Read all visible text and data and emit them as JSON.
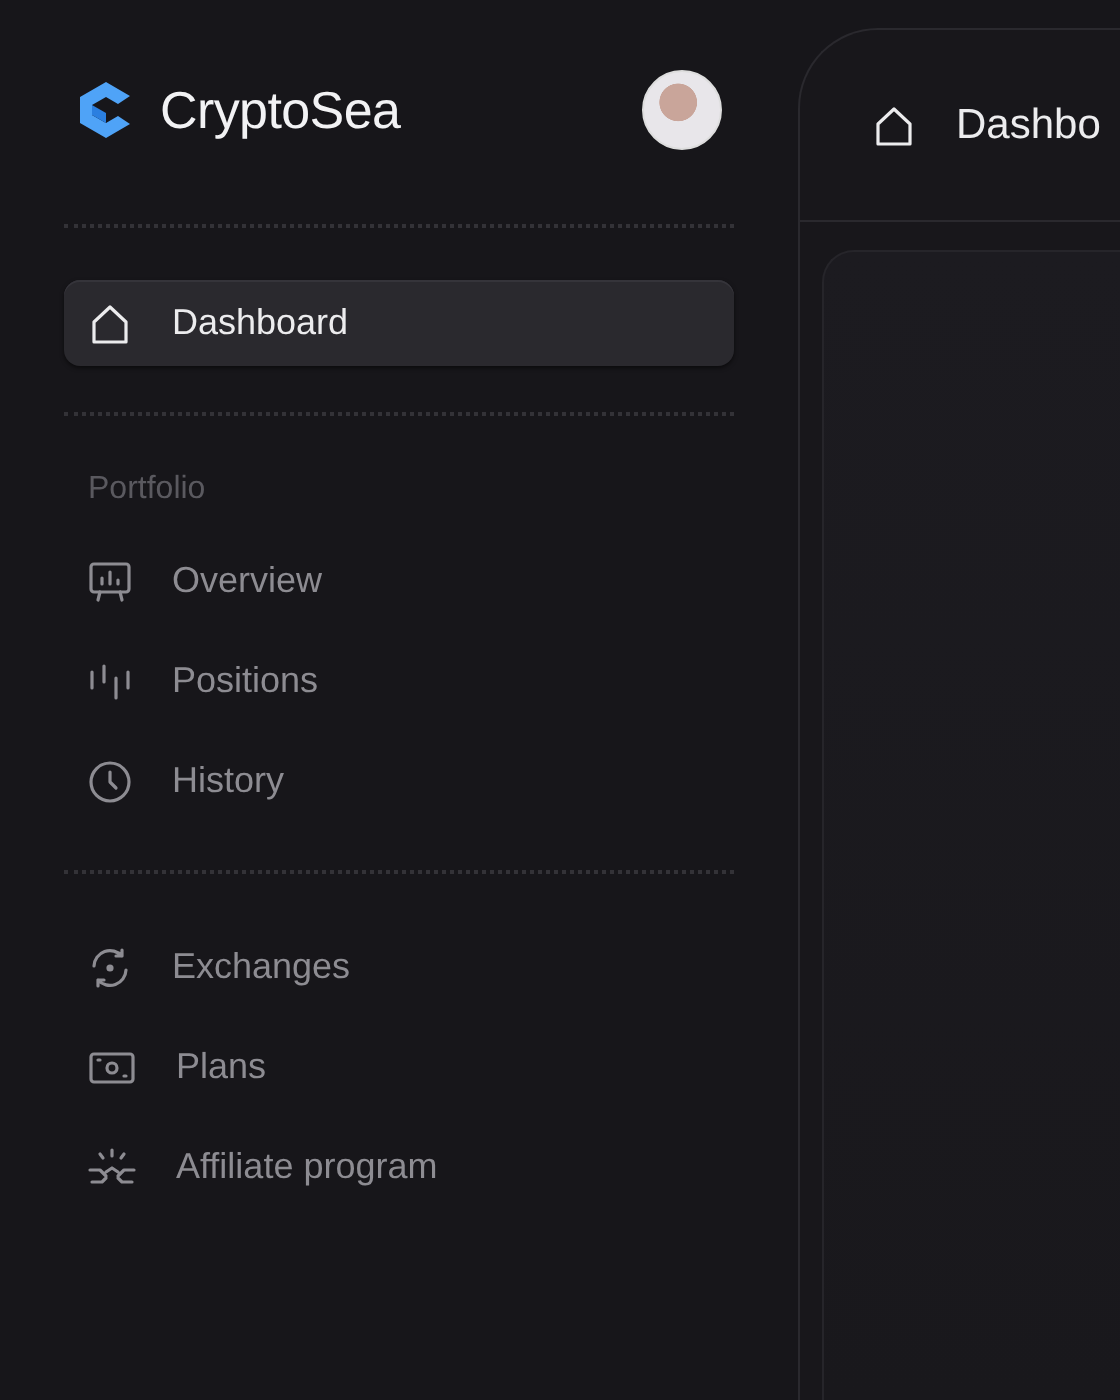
{
  "brand": {
    "name": "CryptoSea"
  },
  "sidebar": {
    "top_items": [
      {
        "label": "Dashboard",
        "selected": true
      }
    ],
    "sections": [
      {
        "heading": "Portfolio",
        "items": [
          {
            "label": "Overview",
            "selected": false
          },
          {
            "label": "Positions",
            "selected": false
          },
          {
            "label": "History",
            "selected": false
          }
        ]
      },
      {
        "items": [
          {
            "label": "Exchanges",
            "selected": false
          },
          {
            "label": "Plans",
            "selected": false
          },
          {
            "label": "Affiliate program",
            "selected": false
          }
        ]
      }
    ]
  },
  "header": {
    "title": "Dashbo"
  }
}
